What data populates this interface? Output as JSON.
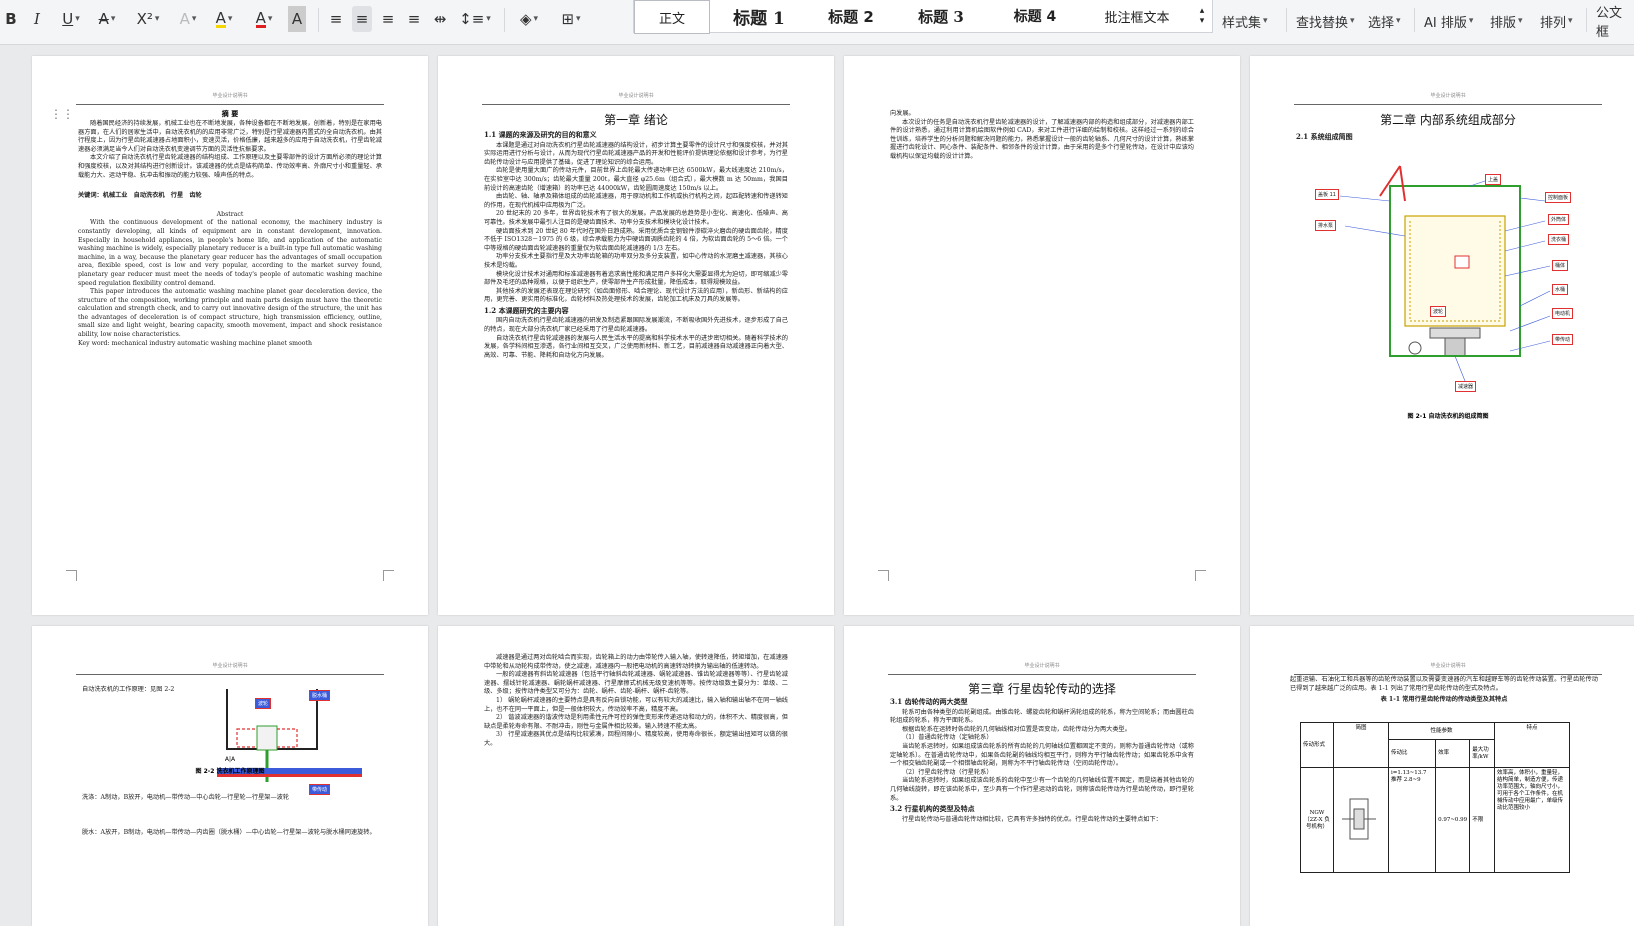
{
  "toolbar": {
    "bold": "B",
    "italic": "I",
    "underline": "U",
    "strike": "A",
    "superscript": "X²",
    "text_effect": "A",
    "highlight": "A",
    "font_color": "A",
    "char_shading": "A",
    "styles": [
      "正文",
      "标题 1",
      "标题 2",
      "标题 3",
      "标题 4",
      "批注框文本"
    ],
    "style_set": "样式集",
    "find_replace": "查找替换",
    "select": "选择",
    "ai_layout": "AI 排版",
    "layout": "排版",
    "arrange": "排列",
    "official_doc": "公文框"
  },
  "header_text": "毕业设计说明书",
  "page1": {
    "title": "摘  要",
    "abstract_cn": [
      "随着国民经济的持续发展，机械工业也在不断地发展，各种设备都在不断地发展，创新着，特别是在家用电器方面，在人们的居家生活中，自动洗衣机的的应用非常广泛，特别是行星减速器内置式的全自动洗衣机，由其行程度上，因为行星齿轮减速器占地面积小，变速灵活，价格低廉，越来越多的应用于自动洗衣机，行星齿轮减速器必须满足当今人们对自动洗衣机变速调节方面的灵活性抗振要求。",
      "本文介绍了自动洗衣机行星齿轮减速器的结构组成、工作原理以及主要零部件的设计方面所必须的理论计算和强度校核，以及对其结构进行创新设计。该减速器的优点是结构简单、传动效率高、外廓尺寸小和重量轻、承载能力大、运动平稳、抗冲击和振动的能力较强、噪声低的特点。"
    ],
    "keywords_cn": "关键词：机械工业　自动洗衣机　行星　齿轮",
    "abstract_en_title": "Abstract",
    "abstract_en": [
      "With the continuous development of the national economy, the machinery industry is constantly developing, all kinds of equipment are in constant development, innovation. Especially in household appliances, in people's home life, and application of the automatic washing machine is widely, especially planetary reducer is a built-in type full automatic washing machine, in a way, because the planetary gear reducer has the advantages of small occupation area, flexible speed, cost is low and very popular, according to the market survey found, planetary gear reducer must meet the needs of today's people of automatic washing machine speed regulation flexibility control demand.",
      "This paper introduces the automatic washing machine planet gear deceleration device, the structure of the composition, working principle and main parts design must have the theoretic calculation and strength check, and to carry out innovative design of the structure, the unit has the advantages of deceleration is of compact structure, high transmission efficiency, outline, small size and light weight, bearing capacity, smooth movement, impact and shock resistance ability, low noise characteristics."
    ],
    "keywords_en": "Key word: mechanical industry    automatic washing machine    planet    smooth"
  },
  "page2": {
    "chapter": "第一章  绪论",
    "sec1": "1.1 课题的来源及研究的目的和意义",
    "paras1": [
      "本课题是通过对自动洗衣机行星齿轮减速器的结构设计，初步计算主要零件的设计尺寸和强度校核，并对其实际运用进行分析与设计，从而为现代行星齿轮减速器产品的开发和性能评价提供理论依据和设计参考，为行星齿轮传动设计与应用提供了基础，促进了理论知识的综合运用。",
      "齿轮是使用量大面广的传动元件，目前世界上齿轮最大传递功率已达 6500kW，最大线速度达 210m/s，在实验室中达 300m/s；齿轮最大重量 200t，最大直径 φ25.6m（组合式），最大模数 m 达 50mm，我国目前设计的高速齿轮（增速箱）的功率已达 44000kW，齿轮圆周速度达 150m/s 以上。",
      "由齿轮、轴、轴承及箱体组成的齿轮减速器，用于原动机和工作机或执行机构之间，起匹配转速和传递转矩的作用，在现代机械中应用极为广泛。",
      "20 世纪末的 20 多年，世界齿轮技术有了很大的发展。产品发展的总趋势是小型化、高速化、低噪声、高可靠性。技术发展中最引人注目的是硬齿面技术、功率分支技术和模块化设计技术。",
      "硬齿面技术到 20 世纪 80 年代时在国外日趋成熟。采用优质合金钢锻件渗碳淬火磨齿的硬齿面齿轮，精度不低于 ISO1328－1975 的 6 级，综合承载能力为中硬齿面调质齿轮的 4 倍，为软齿面齿轮的 5～6 倍。一个中等规格的硬齿面齿轮减速器的重量仅为软齿面齿轮减速器的 1/3 左右。",
      "功率分支技术主要指行星及大功率齿轮箱的功率双分及多分支装置，如中心传动的水泥磨主减速器，其核心技术是均载。",
      "模块化设计技术对通用和标准减速器有着追求高性能和满足用户多样化大需要显得尤为迫切，即可缩减少零部件及毛坯的品种规格，以便于组织生产，使零部件生产形成批量，降低成本，取得规模效益。",
      "其他技术的发展还表现在理论研究（如齿面修形、啮合理论、现代设计方法的应用），新齿形、新结构的应用，更完善、更实用的标准化，齿轮材料及热处理技术的发展，齿轮加工机床及刀具的发展等。"
    ],
    "sec2": "1.2  本课题研究的主要内容",
    "paras2": [
      "国内自动洗衣机行星齿轮减速器的研发及制造紧跟国际发展潮流，不断吸收国外先进技术，逐步形成了自己的特点，现在大部分洗衣机厂家已经采用了行星齿轮减速器。",
      "自动洗衣机行星齿轮减速器的发展与人民生活水平的提高和科学技术水平的进步密切相关。随着科学技术的发展，各学科间相互渗透，各行业间相互交叉，广泛使用新材料、新工艺，目前减速器自动减速器正向着大型、高效、可靠、节能、降耗和自动化方向发展。"
    ]
  },
  "page3": {
    "paras": [
      "向发展。",
      "本次设计的任务是自动洗衣机行星齿轮减速器的设计，了解减速器内部的构造和组成部分，对减速器内部工件的设计熟悉，通过利用计算机绘图软件例如 CAD，来对工件进行详细的绘制和校核。这样经过一系列的综合性训练，培养学生的分析问题和解决问题的能力，熟悉掌握设计一般的齿轮轴系、几何尺寸的设计计算，熟练掌握进行齿轮设计、同心条件、装配条件、相邻条件的设计计算，由于采用的是多个行星轮传动，在设计中应该均载机构以保证均载的设计计算。"
    ]
  },
  "page4": {
    "chapter": "第二章  内部系统组成部分",
    "sec": "2.1 系统组成简图",
    "labels": [
      "盖板 11",
      "上盖",
      "控制面板",
      "外筒体",
      "排水泵",
      "洗衣桶",
      "波轮",
      "桶体",
      "水桶",
      "电动机",
      "带传动",
      "减速器"
    ],
    "caption": "图 2-1  自动洗衣机的组成简图"
  },
  "page5": {
    "intro": "自动洗衣机的工作原理：见图 2-2",
    "label_a": "波轮",
    "label_b": "脱水桶",
    "label_c": "带传动",
    "label_d": "A|A",
    "caption": "图 2-2  洗衣机工作原理图",
    "wash": "洗涤：A制动，B放开，电动机—带传动—中心齿轮—行星轮—行星架—波轮",
    "spin": "脱水：A放开，B制动，电动机—带传动—内齿圈（脱水桶）—中心齿轮—行星架—波轮与脱水桶同速旋转。"
  },
  "page6": {
    "paras": [
      "减速器是通过两对齿轮啮合而实现，齿轮箱上的动力由带轮传入输入轴，使转速降低，转矩增加，在减速器中带轮和从动轮构成带传动，使之减速，减速器内一般把电动机的高速转动转换为输出轴的低速转动。",
      "一般的减速器有斜齿轮减速器（包括平行轴斜齿轮减速器、蜗轮减速器、锥齿轮减速器等等）、行星齿轮减速器、摆线针轮减速器、蜗轮蜗杆减速器、行星摩擦式机械无级变速机等等。按传动级数主要分为：单级、二级、多级；按传动件类型又可分为：齿轮、蜗杆、齿轮-蜗杆、蜗杆-齿轮等。",
      "1）  蜗轮蜗杆减速器的主要特点是具有反向自锁功能，可以有较大的减速比，输入轴和输出轴不在同一轴线上，也不在同一平面上，但是一般体积较大，传动效率不高，精度不高。",
      "2）  谐波减速器的谐波传动是利用柔性元件可控的弹性变形来传递运动和动力的，体积不大、精度很高，但缺点是柔轮寿命有限、不耐冲击，刚性与金属件相比较差。输入转速不能太高。",
      "3）  行星减速器其优点是结构比较紧凑，回程间隙小、精度较高，使用寿命很长，额定输出扭矩可以做的很大。"
    ]
  },
  "page7": {
    "chapter": "第三章  行星齿轮传动的选择",
    "sec1": "3.1 齿轮传动的两大类型",
    "paras1": [
      "轮系可由各种类型的齿轮副组成。由锥齿轮、螺旋齿轮和蜗杆涡轮组成的轮系，称为空间轮系；而由圆柱齿轮组成的轮系，称为平面轮系。",
      "根据齿轮系在运转时各齿轮的几何轴线相对位置是否变动，齿轮传动分为两大类型。",
      "（1）普通齿轮传动（定轴轮系）",
      "当齿轮系运转时，如果组成该齿轮系的所有齿轮的几何轴线位置都固定不变的，则称为普通齿轮传动（或称定轴轮系）。在普通齿轮传动中，如果各齿轮副的轴线均相互平行，则称为平行轴齿轮传动；如果齿轮系中含有一个相交轴齿轮副或一个相错轴齿轮副，则称为不平行轴齿轮传动（空间齿轮传动）。",
      "（2）行星齿轮传动（行星轮系）",
      "当齿轮系运转时，如果组成该齿轮系的齿轮中至少有一个齿轮的几何轴线位置不固定，而是绕着其他齿轮的几何轴线旋转，即在该齿轮系中，至少具有一个作行星运动的齿轮，则称该齿轮传动为行星齿轮传动，即行星轮系。"
    ],
    "sec2": "3.2 行星机构的类型及特点",
    "paras2": [
      "行星齿轮传动与普通齿轮传动相比较，它具有许多独特的优点。行星齿轮传动的主要特点如下："
    ]
  },
  "page8": {
    "intro": "起重运输、石油化工和兵器等的齿轮传动装置以及需要变速器的汽车和越野车等的齿轮传动装置。行星齿轮传动已得到了越来越广泛的应用。表 1-1 列出了常用行星齿轮传动的型式及特点。",
    "table_title": "表 1-1  常用行星齿轮传动的传动类型及其特点",
    "headers": [
      "传动形式",
      "简图",
      "性能参数",
      "特点"
    ],
    "sub_headers": [
      "传动比",
      "效率",
      "最大功率/kW"
    ],
    "row": {
      "name": "NGW（2Z-X 负号机构）",
      "ratio": "i=1.13~13.7 推荐 2.8~9",
      "efficiency": "0.97~0.99",
      "power": "不限",
      "feature": "效率高，体积小，重量轻，结构简单，制造方便，传递功率范围大，轴向尺寸小，可用于各个工作条件，在机械传动中应用最广，单级传动比范围较小"
    }
  }
}
